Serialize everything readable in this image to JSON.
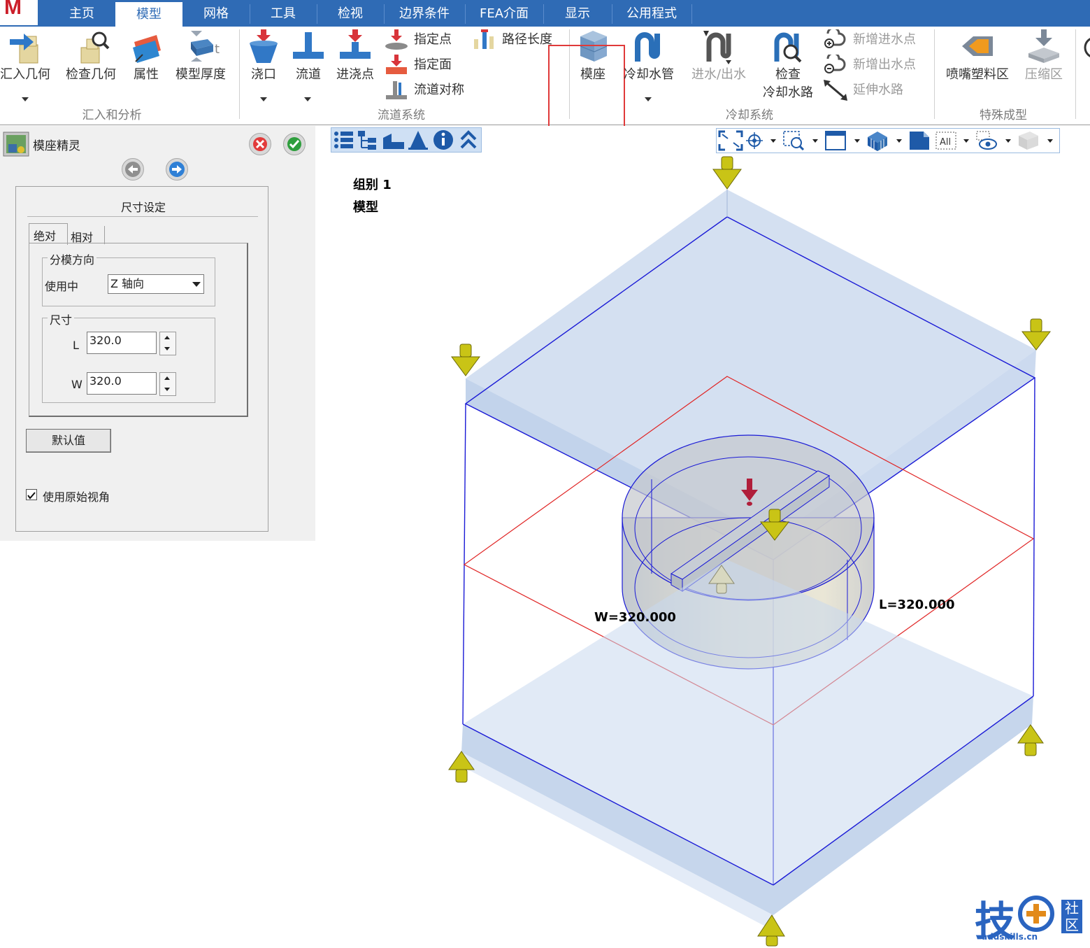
{
  "menu": {
    "logo": "M",
    "tabs": [
      "主页",
      "模型",
      "网格",
      "工具",
      "检视",
      "边界条件",
      "FEA介面",
      "显示",
      "公用程式"
    ],
    "active_tab": "模型"
  },
  "ribbon": {
    "import_geometry": "汇入几何",
    "check_geometry": "检查几何",
    "properties": "属性",
    "model_thickness": "模型厚度",
    "gate": "浇口",
    "runner": "流道",
    "injection_point": "进浇点",
    "assign_point": "指定点",
    "assign_face": "指定面",
    "runner_symmetry": "流道对称",
    "path_length": "路径长度",
    "mold_base": "模座",
    "cooling_pipe": "冷却水管",
    "inlet_outlet": "进水/出水",
    "check_cooling_1": "检查",
    "check_cooling_2": "冷却水路",
    "add_inlet": "新增进水点",
    "add_outlet": "新增出水点",
    "extend_channel": "延伸水路",
    "nozzle_zone": "喷嘴塑料区",
    "compression_zone": "压缩区",
    "groups": {
      "import_analysis": "汇入和分析",
      "runner_system": "流道系统",
      "cooling_system": "冷却系统",
      "special_molding": "特殊成型"
    }
  },
  "wizard": {
    "title": "模座精灵",
    "size_setting": "尺寸设定",
    "tab_absolute": "绝对",
    "tab_relative": "相对",
    "parting_direction": "分模方向",
    "in_use": "使用中",
    "direction_value": "Z 轴向",
    "size_group": "尺寸",
    "L_label": "L",
    "L_value": "320.0",
    "W_label": "W",
    "W_value": "320.0",
    "default_button": "默认值",
    "use_original_view": "使用原始视角",
    "use_original_view_checked": true
  },
  "viewport": {
    "toolbar_all": "All",
    "group_label": "组别 1",
    "model_label": "模型",
    "w_dim": "W=320.000",
    "l_dim": "L=320.000"
  },
  "watermark": {
    "char": "技",
    "badge_1": "社",
    "badge_2": "区",
    "url": "addskills.cn"
  }
}
